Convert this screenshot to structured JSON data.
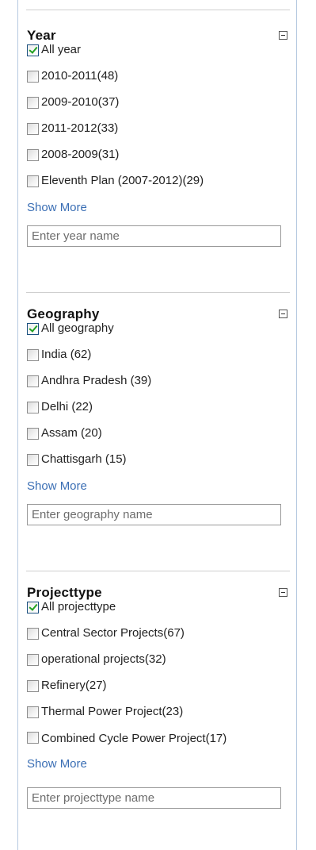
{
  "facets": [
    {
      "title": "Year",
      "options": [
        {
          "label": "All year",
          "checked": true
        },
        {
          "label": "2010-2011(48)",
          "checked": false
        },
        {
          "label": "2009-2010(37)",
          "checked": false
        },
        {
          "label": "2011-2012(33)",
          "checked": false
        },
        {
          "label": "2008-2009(31)",
          "checked": false
        },
        {
          "label": "Eleventh Plan (2007-2012)(29)",
          "checked": false
        }
      ],
      "show_more": "Show More",
      "search_placeholder": "Enter year name"
    },
    {
      "title": "Geography",
      "options": [
        {
          "label": "All geography",
          "checked": true
        },
        {
          "label": "India (62)",
          "checked": false
        },
        {
          "label": "Andhra Pradesh (39)",
          "checked": false
        },
        {
          "label": "Delhi (22)",
          "checked": false
        },
        {
          "label": "Assam (20)",
          "checked": false
        },
        {
          "label": "Chattisgarh (15)",
          "checked": false
        }
      ],
      "show_more": "Show More",
      "search_placeholder": "Enter geography name"
    },
    {
      "title": "Projecttype",
      "options": [
        {
          "label": "All projecttype",
          "checked": true
        },
        {
          "label": "Central Sector Projects(67)",
          "checked": false
        },
        {
          "label": "operational projects(32)",
          "checked": false
        },
        {
          "label": "Refinery(27)",
          "checked": false
        },
        {
          "label": "Thermal Power Project(23)",
          "checked": false
        },
        {
          "label": "Combined Cycle Power Project(17)",
          "checked": false
        }
      ],
      "show_more": "Show More",
      "search_placeholder": "Enter projecttype name"
    }
  ],
  "colors": {
    "panel_border": "#b6c9e0",
    "link": "#3a6eb4",
    "check": "#21a121",
    "separator": "#cfcfcf"
  },
  "icons": {
    "collapse": "collapse-minus-icon",
    "checkbox": "checkbox-icon"
  }
}
